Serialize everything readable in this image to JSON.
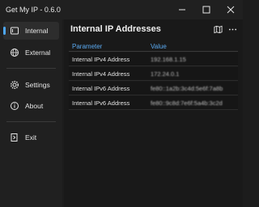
{
  "app": {
    "title": "Get My IP - 0.6.0"
  },
  "sidebar": {
    "items": [
      {
        "label": "Internal",
        "icon": "network-card-icon",
        "active": true
      },
      {
        "label": "External",
        "icon": "globe-icon",
        "active": false
      },
      {
        "label": "Settings",
        "icon": "gear-icon",
        "active": false
      },
      {
        "label": "About",
        "icon": "info-icon",
        "active": false
      },
      {
        "label": "Exit",
        "icon": "exit-icon",
        "active": false
      }
    ]
  },
  "main": {
    "title": "Internal IP Addresses",
    "table": {
      "headers": [
        "Parameter",
        "Value"
      ],
      "rows": [
        {
          "parameter": "Internal IPv4 Address",
          "value": "192.168.1.15"
        },
        {
          "parameter": "Internal IPv4 Address",
          "value": "172.24.0.1"
        },
        {
          "parameter": "Internal IPv6 Address",
          "value": "fe80::1a2b:3c4d:5e6f:7a8b"
        },
        {
          "parameter": "Internal IPv6 Address",
          "value": "fe80::9c8d:7e6f:5a4b:3c2d"
        }
      ]
    }
  },
  "colors": {
    "accent": "#4ea7f5",
    "background": "#1c1c1c",
    "sidebar": "#202020"
  }
}
